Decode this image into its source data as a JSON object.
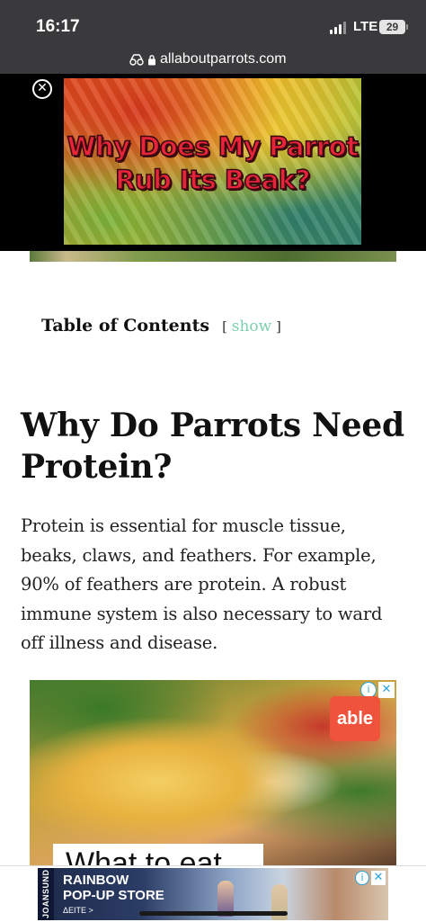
{
  "status_bar": {
    "time": "16:17",
    "network": "LTE",
    "battery": "29"
  },
  "url_bar": {
    "domain": "allaboutparrots.com"
  },
  "video_ad": {
    "close_symbol": "✕",
    "title_line1": "Why Does My Parrot",
    "title_line2": "Rub Its Beak?"
  },
  "toc": {
    "title": "Table of Contents",
    "bracket_open": "[",
    "show_label": "show",
    "bracket_close": "]"
  },
  "article": {
    "heading": "Why Do Parrots Need Protein?",
    "paragraph": "Protein is essential for muscle tissue, beaks, claws, and feathers. For example, 90% of feathers are protein. A robust immune system is also necessary to ward off illness and disease."
  },
  "food_ad": {
    "brand": "able",
    "caption": "What to eat",
    "info_symbol": "i",
    "close_symbol": "✕"
  },
  "bottom_ad": {
    "brand_vertical": "JOANSUND",
    "line1": "RAINBOW",
    "line2": "POP-UP STORE",
    "sub": "ΔEITE >",
    "info_symbol": "i",
    "close_symbol": "✕"
  },
  "icons": {
    "reader": "reader-icon",
    "lock": "lock-icon",
    "signal": "signal-icon",
    "battery": "battery-icon"
  },
  "colors": {
    "toc_link": "#7fcfae",
    "chrome": "#3a3a3c",
    "able_brand": "#f0533b",
    "ad_choice": "#2aa3d8"
  }
}
